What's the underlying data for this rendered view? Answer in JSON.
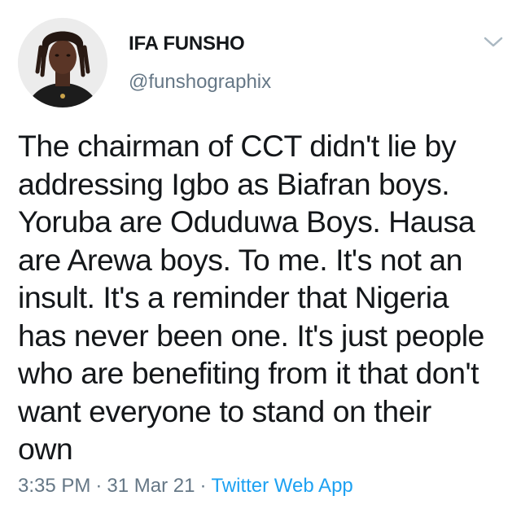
{
  "user": {
    "display_name": "IFA FUNSHO",
    "handle": "@funshographix"
  },
  "icons": {
    "avatar": "profile-photo",
    "menu": "chevron-down-icon"
  },
  "tweet": {
    "lines": [
      "The chairman of CCT didn't lie by",
      "addressing Igbo as Biafran boys.",
      "Yoruba are Oduduwa Boys. Hausa",
      "are Arewa boys. To me. It's not an",
      "insult. It's a reminder that Nigeria",
      "has never been one. It's just people",
      "who are benefiting from it that don't",
      "want everyone to stand on their",
      "own"
    ]
  },
  "meta": {
    "time": "3:35 PM",
    "separator": "·",
    "date": "31 Mar 21",
    "source": "Twitter Web App"
  },
  "colors": {
    "text": "#14171a",
    "secondary": "#657786",
    "link": "#1da1f2",
    "chevron": "#aab8c2"
  }
}
